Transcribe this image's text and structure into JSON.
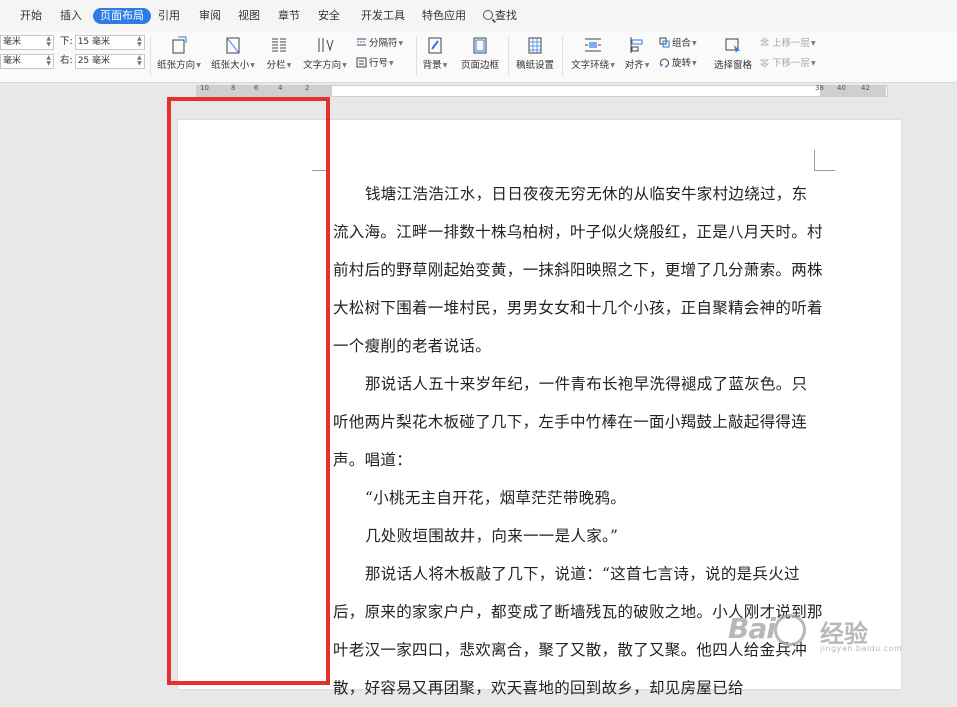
{
  "menubar": {
    "tabs": [
      "开始",
      "插入",
      "页面布局",
      "引用",
      "审阅",
      "视图",
      "章节",
      "安全",
      "开发工具",
      "特色应用"
    ],
    "search_label": "查找",
    "active_tab": "页面布局"
  },
  "ribbon": {
    "margins": {
      "left_top_value": "毫米",
      "left_bottom_value": "毫米",
      "bottom_label": "下:",
      "bottom_value": "15 毫米",
      "right_label": "右:",
      "right_value": "25 毫米"
    },
    "buttons": {
      "orientation": "纸张方向",
      "size": "纸张大小",
      "columns": "分栏",
      "text_direction": "文字方向",
      "separator": "分隔符",
      "line_number": "行号",
      "background": "背景",
      "page_border": "页面边框",
      "manuscript": "稿纸设置",
      "text_wrap": "文字环绕",
      "align": "对齐",
      "group": "组合",
      "rotate": "旋转",
      "selection_pane": "选择窗格",
      "bring_forward": "上移一层",
      "send_backward": "下移一层"
    }
  },
  "ruler": {
    "left_numbers": [
      "10",
      "8",
      "6",
      "4",
      "2"
    ],
    "right_numbers": [
      "38",
      "40",
      "42"
    ]
  },
  "document": {
    "paragraphs": [
      {
        "indent": true,
        "text": "钱塘江浩浩江水，日日夜夜无穷无休的从临安牛家村边绕过，东流入海。江畔一排数十株乌柏树，叶子似火烧般红，正是八月天时。村前村后的野草刚起始变黄，一抹斜阳映照之下，更增了几分萧索。两株大松树下围着一堆村民，男男女女和十几个小孩，正自聚精会神的听着一个瘦削的老者说话。"
      },
      {
        "indent": true,
        "text": "那说话人五十来岁年纪，一件青布长袍早洗得褪成了蓝灰色。只听他两片梨花木板碰了几下，左手中竹棒在一面小羯鼓上敲起得得连声。唱道："
      },
      {
        "indent": true,
        "text": "“小桃无主自开花，烟草茫茫带晚鸦。"
      },
      {
        "indent": true,
        "text": "几处败垣围故井，向来一一是人家。”"
      },
      {
        "indent": true,
        "text": "那说话人将木板敲了几下，说道：“这首七言诗，说的是兵火过后，原来的家家户户，都变成了断墙残瓦的破败之地。小人刚才说到那叶老汉一家四口，悲欢离合，聚了又散，散了又聚。他四人给金兵冲散，好容易又再团聚，欢天喜地的回到故乡，却见房屋已给"
      }
    ]
  },
  "watermark": {
    "latin": "Bai",
    "cn": "经验",
    "sub": "jingyan.baidu.com"
  },
  "colors": {
    "active_tab": "#2d7be5",
    "highlight_border": "#e63030"
  }
}
